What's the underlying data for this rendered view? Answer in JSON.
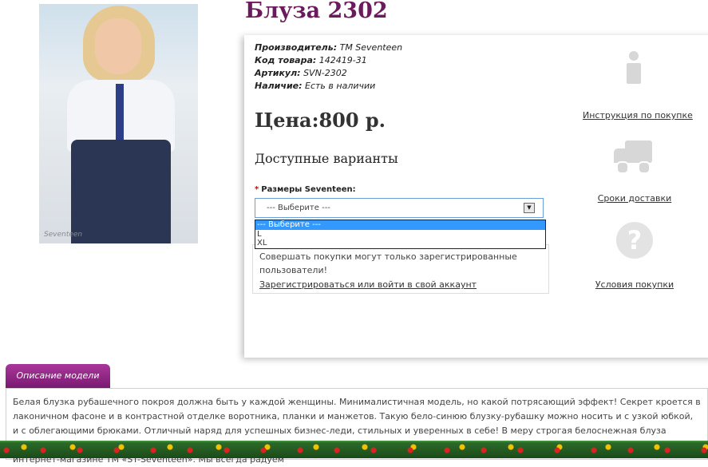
{
  "product": {
    "title": "Блуза 2302",
    "image_watermark": "Seventeen"
  },
  "specs": {
    "manufacturer_label": "Производитель:",
    "manufacturer_value": "TM Seventeen",
    "code_label": "Код товара:",
    "code_value": "142419-31",
    "article_label": "Артикул:",
    "article_value": "SVN-2302",
    "availability_label": "Наличие:",
    "availability_value": "Есть в наличии"
  },
  "price": "Цена:800 р.",
  "variants_heading": "Доступные варианты",
  "size": {
    "required_mark": "*",
    "label": "Размеры Seventeen:",
    "selected": "--- Выберите ---",
    "options": [
      "--- Выберите ---",
      "L",
      "XL"
    ]
  },
  "notice": {
    "text": "Совершать покупки могут только зарегистрированные пользователи!",
    "login_link": "Зарегистрироваться или войти в свой аккаунт"
  },
  "side_links": {
    "instruction": "Инструкция по покупке",
    "delivery": "Сроки доставки",
    "terms": "Условия покупки",
    "icons": [
      "info-icon",
      "truck-icon",
      "question-icon"
    ]
  },
  "description": {
    "tab_label": "Описание модели",
    "text": "Белая блузка рубашечного покроя должна быть у каждой женщины. Минималистичная модель, но какой потрясающий эффект! Секрет кроется в лаконичном фасоне и в контрастной отделке воротника, планки и манжетов. Такую бело-синюю блузку-рубашку можно носить и с узкой юбкой, и с облегающими брюками. Отличный наряд для успешных бизнес-леди, стильных и уверенных в себе! В меру строгая белоснежная блуза выглядит очень привлекательно и придает ее обладательнице обворожительный вид. Купить эту шикарную новинку недорого можно только в интернет-магазине ТМ «ST-Seventeen». Мы всегда радуем"
  },
  "colors": {
    "title": "#6b1a5c",
    "tab": "#8e2683",
    "dropdown_highlight": "#3399ff"
  }
}
